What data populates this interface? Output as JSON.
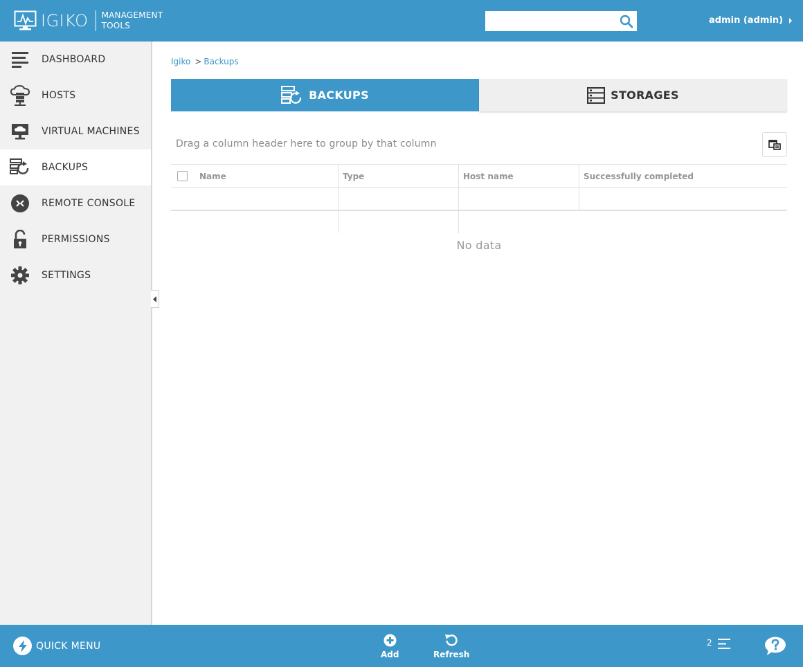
{
  "header": {
    "logo_name": "IGIKO",
    "logo_sub_line1": "MANAGEMENT",
    "logo_sub_line2": "TOOLS",
    "search_value": "",
    "user_label": "admin (admin)"
  },
  "sidebar": {
    "items": [
      {
        "label": "DASHBOARD",
        "icon": "dashboard-icon"
      },
      {
        "label": "HOSTS",
        "icon": "hosts-cloud-server-icon"
      },
      {
        "label": "VIRTUAL MACHINES",
        "icon": "monitor-cloud-icon"
      },
      {
        "label": "BACKUPS",
        "icon": "backups-icon",
        "active": true
      },
      {
        "label": "REMOTE CONSOLE",
        "icon": "remote-console-icon"
      },
      {
        "label": "PERMISSIONS",
        "icon": "unlocked-padlock-icon"
      },
      {
        "label": "SETTINGS",
        "icon": "gear-icon"
      }
    ]
  },
  "breadcrumb": {
    "root": "Igiko",
    "separator": ">",
    "current": "Backups"
  },
  "tabs": [
    {
      "label": "BACKUPS",
      "active": true,
      "icon": "backups-icon"
    },
    {
      "label": "STORAGES",
      "active": false,
      "icon": "storage-icon"
    }
  ],
  "grid": {
    "group_panel_text": "Drag a column header here to group by that column",
    "columns": [
      "Name",
      "Type",
      "Host name",
      "Successfully completed"
    ],
    "rows": [],
    "empty_text": "No data"
  },
  "footer": {
    "quick_menu_label": "QUICK MENU",
    "add_label": "Add",
    "refresh_label": "Refresh",
    "notification_count": "2"
  },
  "colors": {
    "brand": "#3d97c8",
    "sidebar_bg": "#f1f1f1",
    "inactive_tab_bg": "#efefef",
    "header_text_muted": "#959595"
  }
}
